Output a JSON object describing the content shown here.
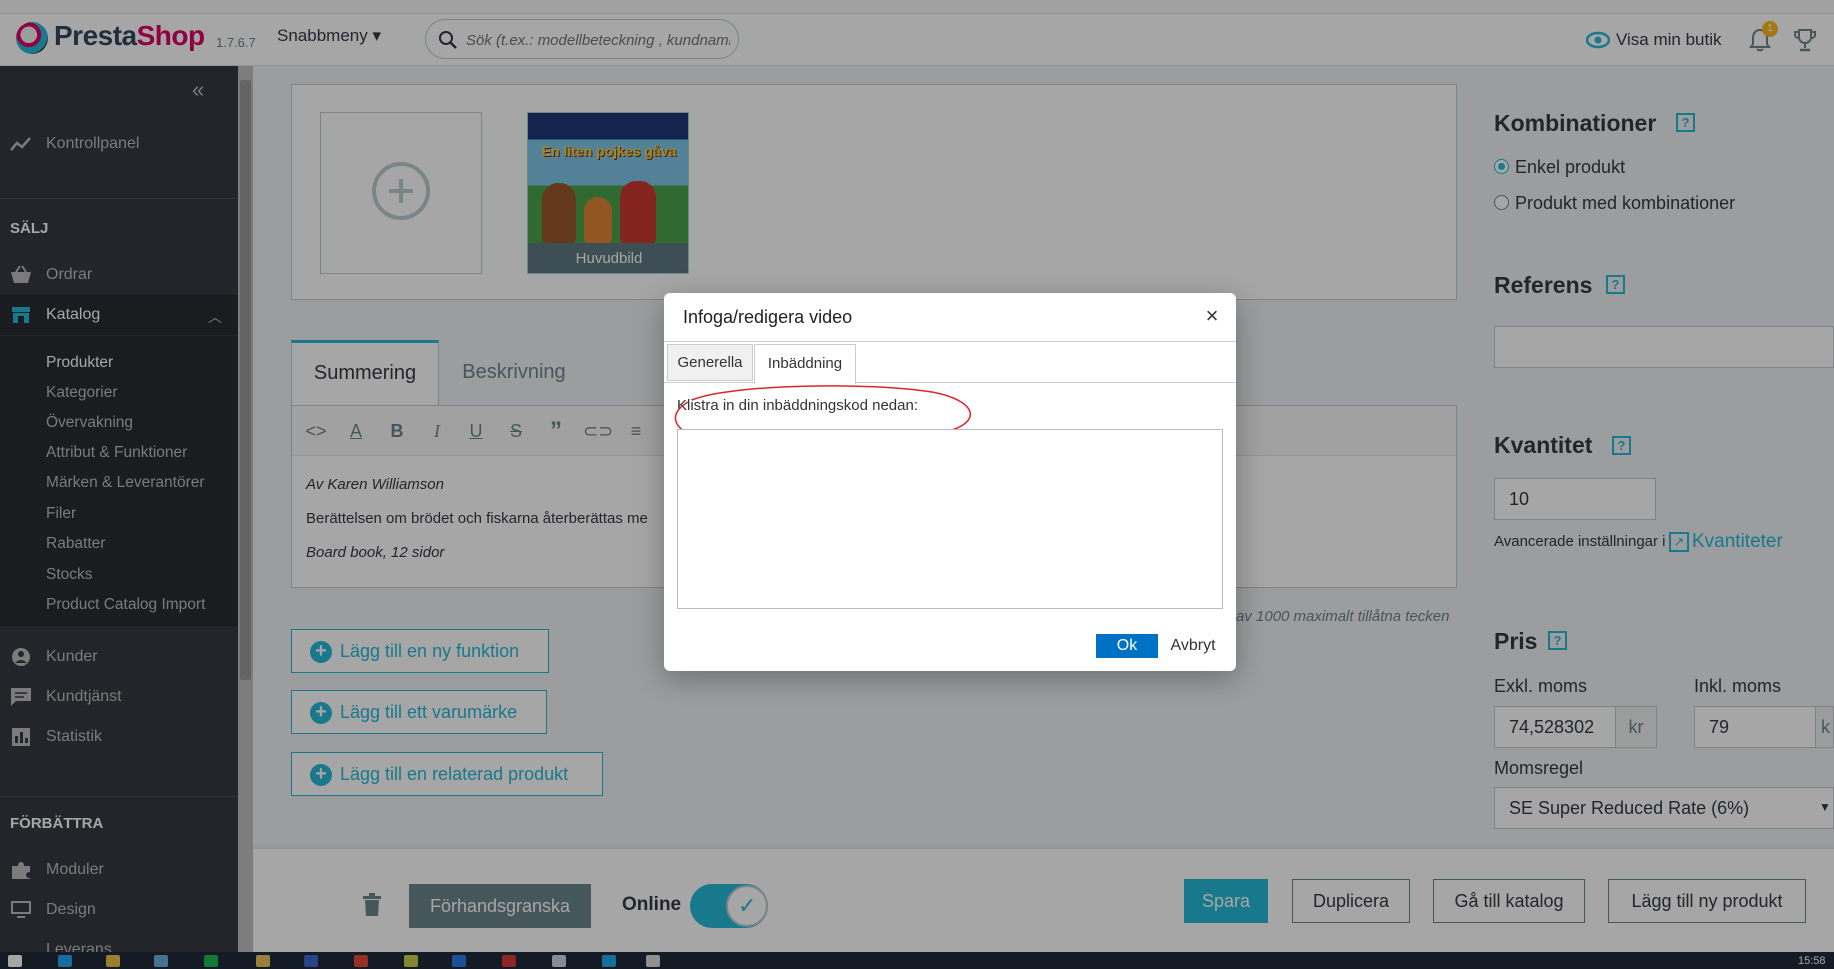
{
  "header": {
    "brand_presta": "Presta",
    "brand_shop": "Shop",
    "version": "1.7.6.7",
    "quick_menu": "Snabbmeny ▾",
    "search_placeholder": "Sök (t.ex.: modellbeteckning , kundnamn",
    "view_shop": "Visa min butik",
    "notification_count": "1"
  },
  "sidebar": {
    "dashboard": "Kontrollpanel",
    "section_sell": "SÄLJ",
    "orders": "Ordrar",
    "catalog": "Katalog",
    "catalog_sub": [
      "Produkter",
      "Kategorier",
      "Övervakning",
      "Attribut & Funktioner",
      "Märken & Leverantörer",
      "Filer",
      "Rabatter",
      "Stocks",
      "Product Catalog Import"
    ],
    "customers": "Kunder",
    "support": "Kundtjänst",
    "stats": "Statistik",
    "section_improve": "FÖRBÄTTRA",
    "modules": "Moduler",
    "design": "Design",
    "shipping": "Leverans"
  },
  "images": {
    "main_label": "Huvudbild",
    "cover_title": "En liten pojkes gåva"
  },
  "editor": {
    "tab_summary": "Summering",
    "tab_description": "Beskrivning",
    "line1": "Av Karen Williamson",
    "line2": "Berättelsen om brödet och fiskarna återberättas me",
    "line3": "Board book, 12 sidor",
    "char_count": "av 1000 maximalt tillåtna tecken"
  },
  "actions": {
    "add_feature": "Lägg till en ny funktion",
    "add_brand": "Lägg till ett varumärke",
    "add_related": "Lägg till en relaterad produkt"
  },
  "right": {
    "combinations_title": "Kombinationer",
    "simple_product": "Enkel produkt",
    "with_combinations": "Produkt med kombinationer",
    "reference_title": "Referens",
    "reference_value": "",
    "quantity_title": "Kvantitet",
    "quantity_value": "10",
    "advanced_settings": "Avancerade inställningar i",
    "quantities_link": "Kvantiteter",
    "price_title": "Pris",
    "excl_vat": "Exkl. moms",
    "incl_vat": "Inkl. moms",
    "price_excl": "74,528302",
    "price_incl": "79",
    "currency": "kr",
    "currency_cut": "k",
    "tax_rule_label": "Momsregel",
    "tax_rule_value": "SE Super Reduced Rate (6%)"
  },
  "bottom": {
    "preview": "Förhandsgranska",
    "online": "Online",
    "save": "Spara",
    "duplicate": "Duplicera",
    "go_catalog": "Gå till katalog",
    "add_product": "Lägg till ny produkt"
  },
  "dialog": {
    "title": "Infoga/redigera video",
    "close": "×",
    "tab_general": "Generella",
    "tab_embed": "Inbäddning",
    "paste_label": "Klistra in din inbäddningskod nedan:",
    "embed_value": "",
    "ok": "Ok",
    "cancel": "Avbryt"
  },
  "taskbar": {
    "clock": "15:58"
  },
  "colors": {
    "accent": "#25b9d7",
    "brand_pink": "#df0067",
    "sidebar_bg": "#363a41",
    "dialog_ok": "#0072c6",
    "annotation_red": "#e0242b"
  }
}
